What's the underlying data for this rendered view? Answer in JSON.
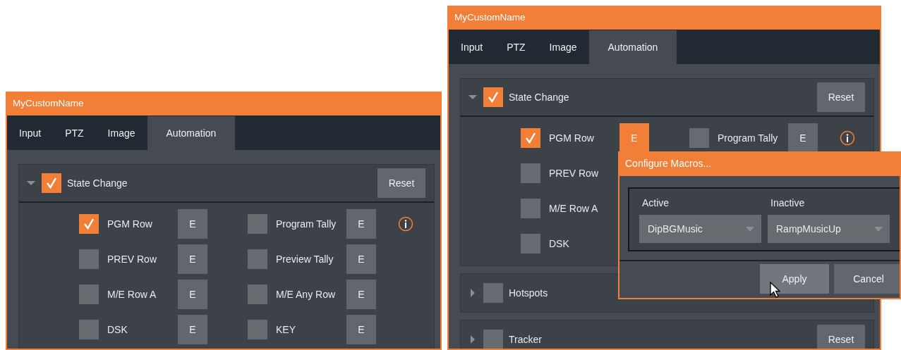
{
  "windows": [
    {
      "title": "MyCustomName",
      "tabs": [
        {
          "label": "Input",
          "selected": false
        },
        {
          "label": "PTZ",
          "selected": false
        },
        {
          "label": "Image",
          "selected": false
        },
        {
          "label": "Automation",
          "selected": true
        }
      ],
      "sections": [
        {
          "label": "State Change",
          "checked": true,
          "expanded": true,
          "reset": "Reset",
          "rows": [
            [
              {
                "label": "PGM Row",
                "checked": true,
                "edit": "E",
                "edit_active": false
              },
              {
                "label": "Program Tally",
                "checked": false,
                "edit": "E",
                "edit_active": false
              }
            ],
            [
              {
                "label": "PREV Row",
                "checked": false,
                "edit": "E",
                "edit_active": false
              },
              {
                "label": "Preview Tally",
                "checked": false,
                "edit": "E",
                "edit_active": false
              }
            ],
            [
              {
                "label": "M/E Row A",
                "checked": false,
                "edit": "E",
                "edit_active": false
              },
              {
                "label": "M/E Any Row",
                "checked": false,
                "edit": "E",
                "edit_active": false
              }
            ],
            [
              {
                "label": "DSK",
                "checked": false,
                "edit": "E",
                "edit_active": false
              },
              {
                "label": "KEY",
                "checked": false,
                "edit": "E",
                "edit_active": false
              }
            ]
          ]
        }
      ]
    },
    {
      "title": "MyCustomName",
      "tabs": [
        {
          "label": "Input",
          "selected": false
        },
        {
          "label": "PTZ",
          "selected": false
        },
        {
          "label": "Image",
          "selected": false
        },
        {
          "label": "Automation",
          "selected": true
        }
      ],
      "sections": [
        {
          "label": "State Change",
          "checked": true,
          "expanded": true,
          "reset": "Reset",
          "rows": [
            [
              {
                "label": "PGM Row",
                "checked": true,
                "edit": "E",
                "edit_active": true
              },
              {
                "label": "Program Tally",
                "checked": false,
                "edit": "E",
                "edit_active": false
              }
            ],
            [
              {
                "label": "PREV Row",
                "checked": false
              }
            ],
            [
              {
                "label": "M/E Row A",
                "checked": false
              }
            ],
            [
              {
                "label": "DSK",
                "checked": false
              }
            ]
          ]
        },
        {
          "label": "Hotspots",
          "checked": false,
          "expanded": false
        },
        {
          "label": "Tracker",
          "checked": false,
          "expanded": false,
          "reset": "Reset"
        }
      ],
      "popup": {
        "title": "Configure Macros...",
        "fields": [
          {
            "label": "Active",
            "value": "DipBGMusic"
          },
          {
            "label": "Inactive",
            "value": "RampMusicUp"
          }
        ],
        "buttons": [
          "Apply",
          "Cancel"
        ]
      }
    }
  ]
}
